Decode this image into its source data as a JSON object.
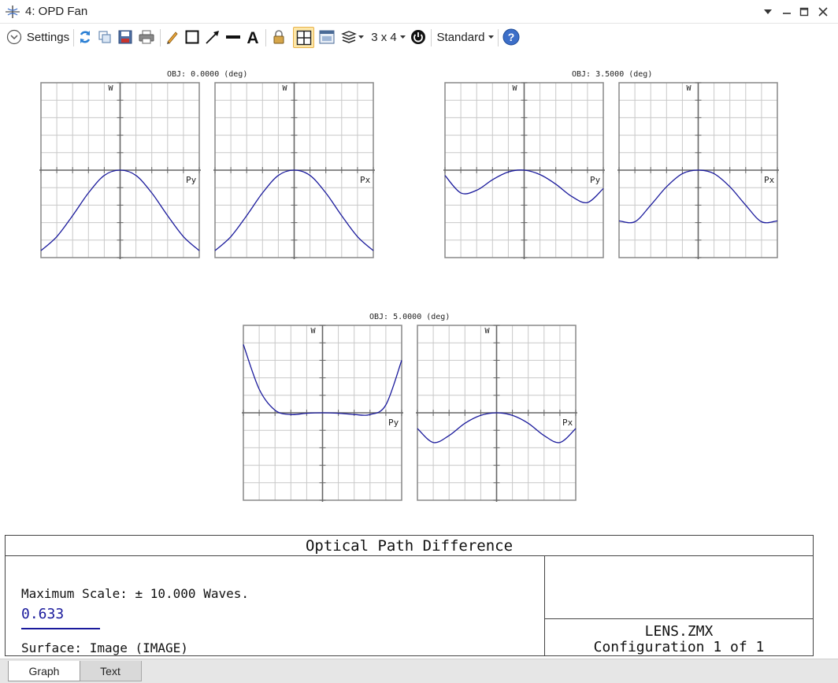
{
  "window": {
    "title": "4: OPD Fan"
  },
  "toolbar": {
    "settings_label": "Settings",
    "layout_label": "3 x 4",
    "style_label": "Standard"
  },
  "colors": {
    "curve": "#1a1a9c",
    "grid": "#c8c8c8",
    "frame": "#888888",
    "accent": "#3c6ec8"
  },
  "plots": [
    {
      "obj_label": "OBJ: 0.0000 (deg)",
      "y_axis_label": "W",
      "tangential": {
        "axis_label": "Py",
        "points": [
          [
            -1,
            -9.2
          ],
          [
            -0.8,
            -7.6
          ],
          [
            -0.6,
            -5.2
          ],
          [
            -0.4,
            -2.6
          ],
          [
            -0.2,
            -0.6
          ],
          [
            0,
            0
          ],
          [
            0.2,
            -0.6
          ],
          [
            0.4,
            -2.6
          ],
          [
            0.6,
            -5.2
          ],
          [
            0.8,
            -7.6
          ],
          [
            1,
            -9.2
          ]
        ]
      },
      "sagittal": {
        "axis_label": "Px",
        "points": [
          [
            -1,
            -9.2
          ],
          [
            -0.8,
            -7.6
          ],
          [
            -0.6,
            -5.2
          ],
          [
            -0.4,
            -2.6
          ],
          [
            -0.2,
            -0.6
          ],
          [
            0,
            0
          ],
          [
            0.2,
            -0.6
          ],
          [
            0.4,
            -2.6
          ],
          [
            0.6,
            -5.2
          ],
          [
            0.8,
            -7.6
          ],
          [
            1,
            -9.2
          ]
        ]
      }
    },
    {
      "obj_label": "OBJ: 3.5000 (deg)",
      "y_axis_label": "W",
      "tangential": {
        "axis_label": "Py",
        "points": [
          [
            -1,
            -0.6
          ],
          [
            -0.8,
            -2.6
          ],
          [
            -0.6,
            -2.3
          ],
          [
            -0.4,
            -1.1
          ],
          [
            -0.2,
            -0.2
          ],
          [
            0,
            0
          ],
          [
            0.2,
            -0.5
          ],
          [
            0.4,
            -1.6
          ],
          [
            0.6,
            -3.0
          ],
          [
            0.8,
            -3.7
          ],
          [
            1,
            -2.1
          ]
        ]
      },
      "sagittal": {
        "axis_label": "Px",
        "points": [
          [
            -1,
            -5.8
          ],
          [
            -0.8,
            -5.9
          ],
          [
            -0.6,
            -4.0
          ],
          [
            -0.4,
            -1.9
          ],
          [
            -0.2,
            -0.4
          ],
          [
            0,
            0
          ],
          [
            0.2,
            -0.4
          ],
          [
            0.4,
            -1.9
          ],
          [
            0.6,
            -4.0
          ],
          [
            0.8,
            -5.9
          ],
          [
            1,
            -5.8
          ]
        ]
      }
    },
    {
      "obj_label": "OBJ: 5.0000 (deg)",
      "y_axis_label": "W",
      "tangential": {
        "axis_label": "Py",
        "points": [
          [
            -1,
            7.8
          ],
          [
            -0.8,
            2.7
          ],
          [
            -0.6,
            0.3
          ],
          [
            -0.4,
            -0.2
          ],
          [
            -0.2,
            -0.05
          ],
          [
            0,
            0
          ],
          [
            0.2,
            -0.05
          ],
          [
            0.4,
            -0.2
          ],
          [
            0.6,
            -0.2
          ],
          [
            0.8,
            0.9
          ],
          [
            1,
            6.0
          ]
        ]
      },
      "sagittal": {
        "axis_label": "Px",
        "points": [
          [
            -1,
            -1.8
          ],
          [
            -0.8,
            -3.4
          ],
          [
            -0.6,
            -2.6
          ],
          [
            -0.4,
            -1.2
          ],
          [
            -0.2,
            -0.3
          ],
          [
            0,
            0
          ],
          [
            0.2,
            -0.3
          ],
          [
            0.4,
            -1.2
          ],
          [
            0.6,
            -2.6
          ],
          [
            0.8,
            -3.4
          ],
          [
            1,
            -1.8
          ]
        ]
      }
    }
  ],
  "info": {
    "title": "Optical Path Difference",
    "max_scale": "Maximum Scale: ± 10.000 Waves.",
    "wavelength": "0.633",
    "surface": "Surface: Image (IMAGE)",
    "filename": "LENS.ZMX",
    "configuration": "Configuration 1 of 1"
  },
  "tabs": [
    {
      "label": "Graph"
    },
    {
      "label": "Text"
    }
  ]
}
